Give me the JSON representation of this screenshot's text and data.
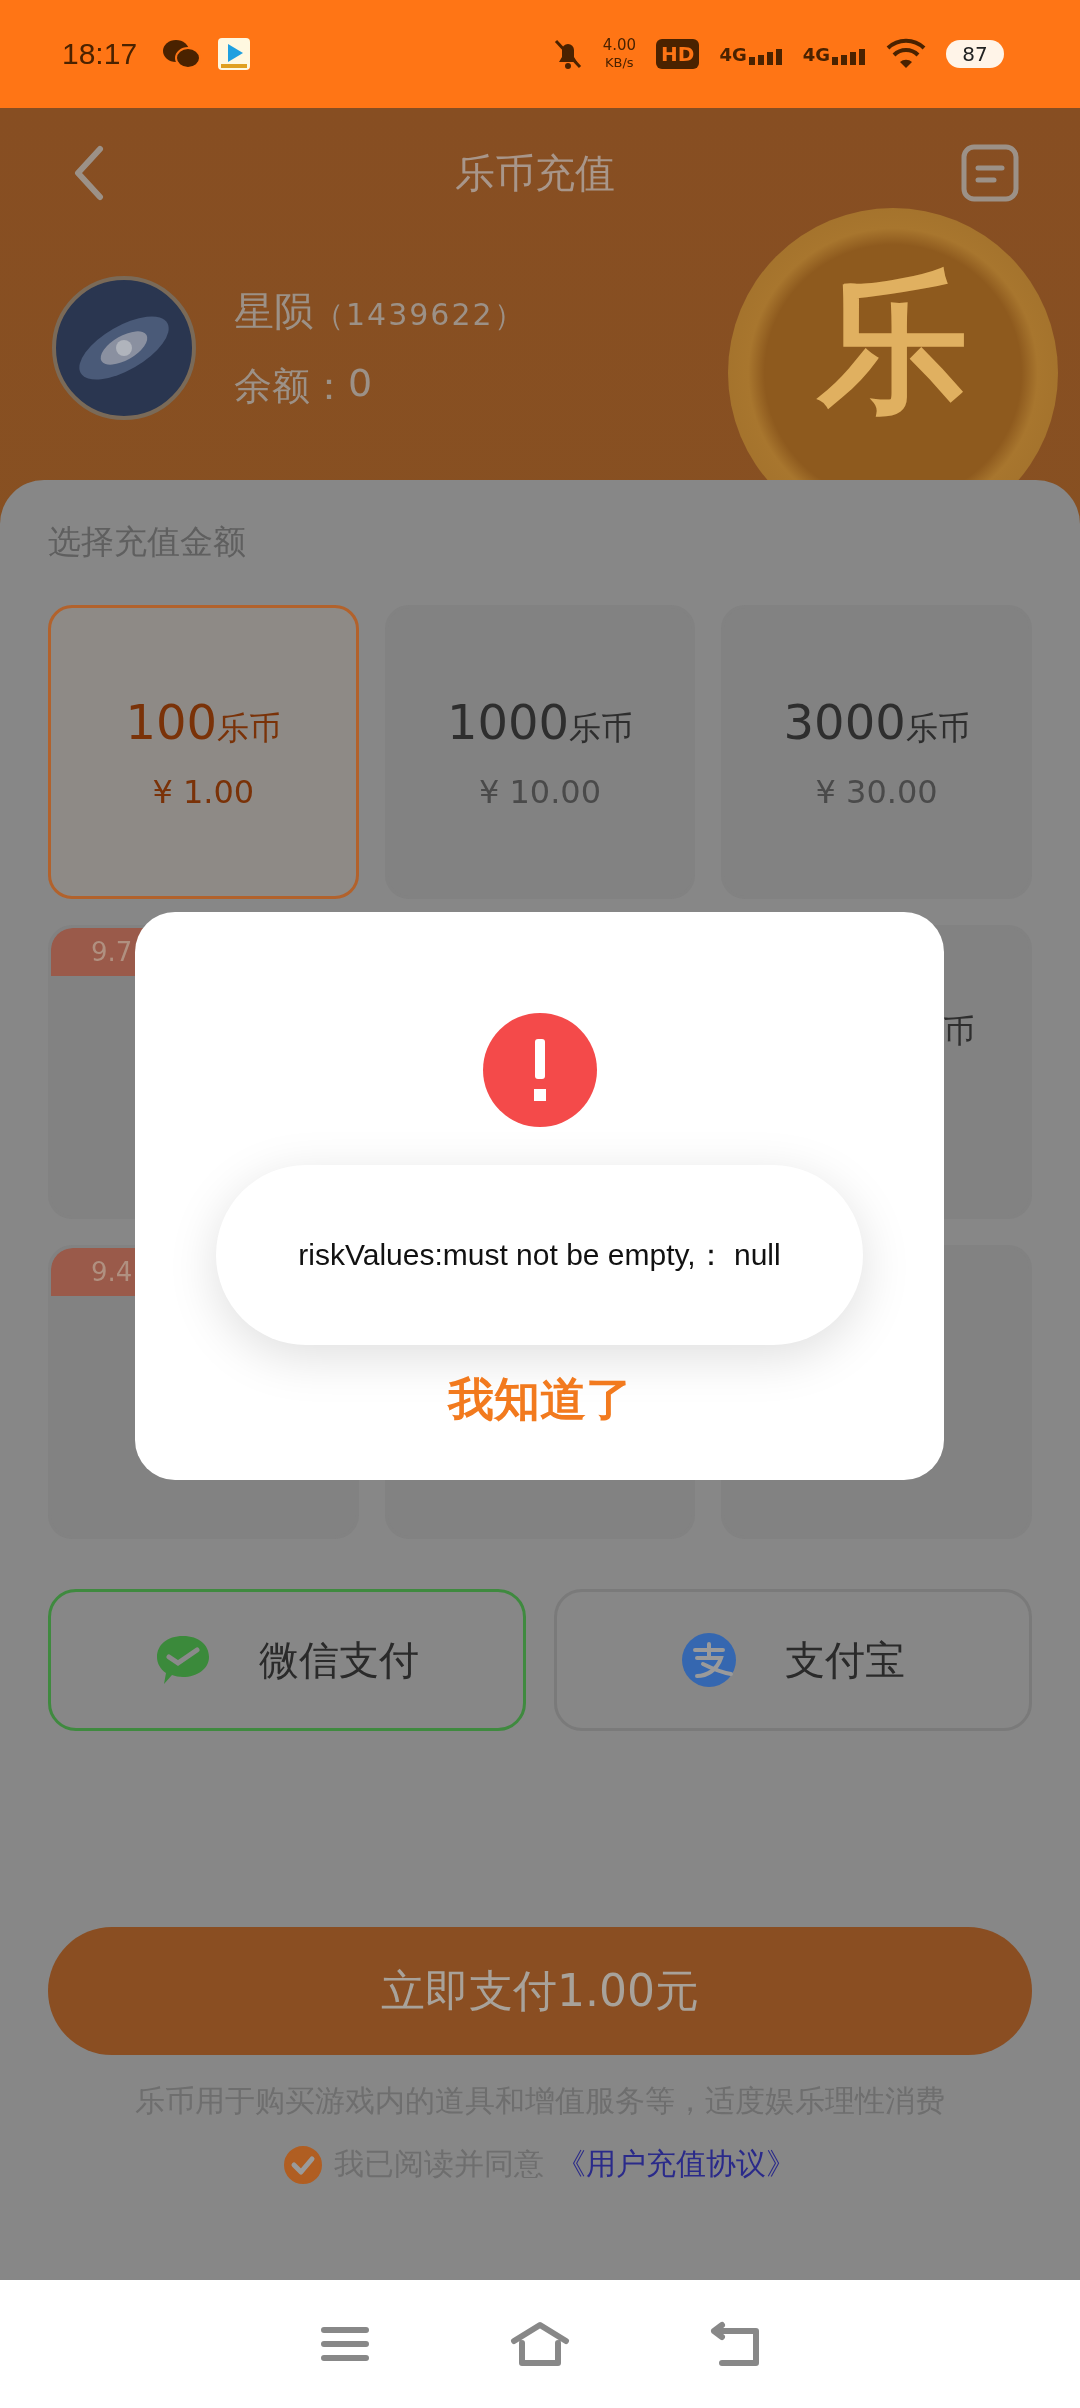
{
  "status_bar": {
    "time": "18:17",
    "net_speed": "4.00",
    "net_unit": "KB/s",
    "hd": "HD",
    "sims": [
      "4G",
      "4G"
    ],
    "battery": "87"
  },
  "header": {
    "title": "乐币充值",
    "coin_char": "乐"
  },
  "user": {
    "name": "星陨",
    "id": "（1439622）",
    "balance_label": "余额：",
    "balance": "0"
  },
  "section_label": "选择充值金额",
  "packages": [
    {
      "coins": "100",
      "unit": "乐币",
      "price": "¥ 1.00",
      "selected": true
    },
    {
      "coins": "1000",
      "unit": "乐币",
      "price": "¥ 10.00",
      "selected": false
    },
    {
      "coins": "3000",
      "unit": "乐币",
      "price": "¥ 30.00",
      "selected": false
    },
    {
      "badge": "9.7",
      "selected": false
    },
    {
      "fragment": "币",
      "selected": false
    },
    {
      "badge": "9.4",
      "selected": false
    },
    {
      "selected": false
    }
  ],
  "payment_methods": [
    {
      "kind": "wechat",
      "label": "微信支付",
      "selected": true
    },
    {
      "kind": "alipay",
      "label": "支付宝",
      "selected": false
    }
  ],
  "pay_button": "立即支付1.00元",
  "notice": "乐币用于购买游戏内的道具和增值服务等，适度娱乐理性消费",
  "agreement": {
    "checked": true,
    "text": "我已阅读并同意",
    "link": "《用户充值协议》"
  },
  "dialog": {
    "toast": "riskValues:must not be empty,： null",
    "button": "我知道了"
  }
}
